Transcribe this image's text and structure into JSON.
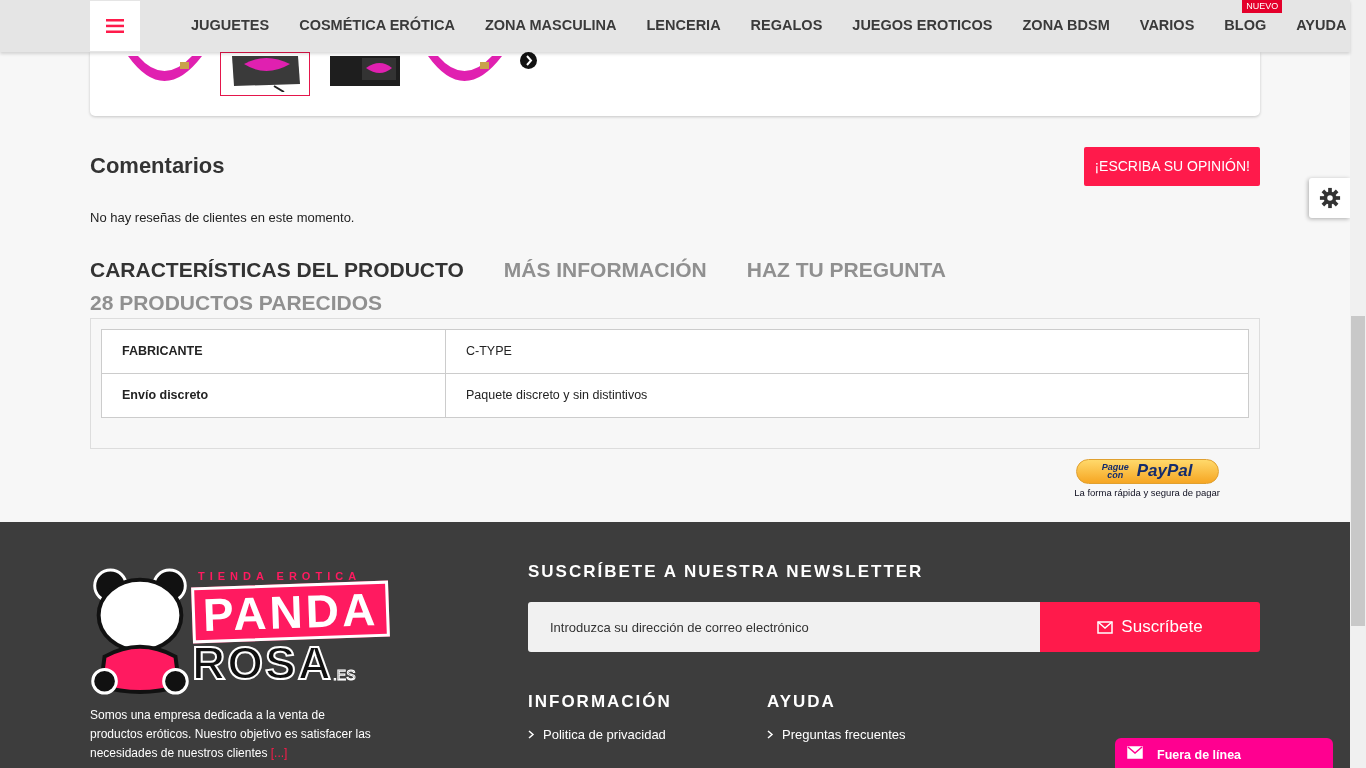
{
  "nav": {
    "items": [
      {
        "label": "JUGUETES"
      },
      {
        "label": "COSMÉTICA ERÓTICA"
      },
      {
        "label": "ZONA MASCULINA"
      },
      {
        "label": "LENCERIA"
      },
      {
        "label": "REGALOS"
      },
      {
        "label": "JUEGOS EROTICOS"
      },
      {
        "label": "ZONA BDSM"
      },
      {
        "label": "VARIOS"
      },
      {
        "label": "BLOG",
        "badge": "NUEVO"
      },
      {
        "label": "AYUDA"
      }
    ]
  },
  "gallery": {
    "thumbnails": [
      {
        "selected": false
      },
      {
        "selected": true
      },
      {
        "selected": false
      },
      {
        "selected": false
      }
    ]
  },
  "reviews": {
    "title": "Comentarios",
    "button": "¡ESCRIBA SU OPINIÓN!",
    "empty_text": "No hay reseñas de clientes en este momento."
  },
  "tabs": [
    {
      "label": "CARACTERÍSTICAS DEL PRODUCTO",
      "selected": true
    },
    {
      "label": "MÁS INFORMACIÓN",
      "selected": false
    },
    {
      "label": "HAZ TU PREGUNTA",
      "selected": false
    },
    {
      "label": "28 PRODUCTOS PARECIDOS",
      "selected": false
    }
  ],
  "features": [
    {
      "name": "FABRICANTE",
      "value": "C-TYPE"
    },
    {
      "name": "Envío discreto",
      "value": "Paquete discreto y sin distintivos"
    }
  ],
  "paypal": {
    "pague": "Pague",
    "con": "con",
    "brand": "PayPal",
    "caption": "La forma rápida y segura de pagar"
  },
  "footer": {
    "logo": {
      "tagline": "TIENDA EROTICA",
      "line1": "PANDA",
      "line2": "ROSA",
      "suffix": ".ES"
    },
    "about": {
      "text": "Somos una empresa dedicada a la venta de productos eróticos. Nuestro objetivo es satisfacer las necesidades de nuestros clientes",
      "more": "[...]"
    },
    "newsletter": {
      "title": "SUSCRÍBETE A NUESTRA NEWSLETTER",
      "placeholder": "Introduzca su dirección de correo electrónico",
      "button": "Suscríbete"
    },
    "columns": [
      {
        "title": "INFORMACIÓN",
        "links": [
          "Politica de privacidad"
        ]
      },
      {
        "title": "AYUDA",
        "links": [
          "Preguntas frecuentes"
        ]
      }
    ]
  },
  "chat": {
    "label": "Fuera de línea"
  }
}
